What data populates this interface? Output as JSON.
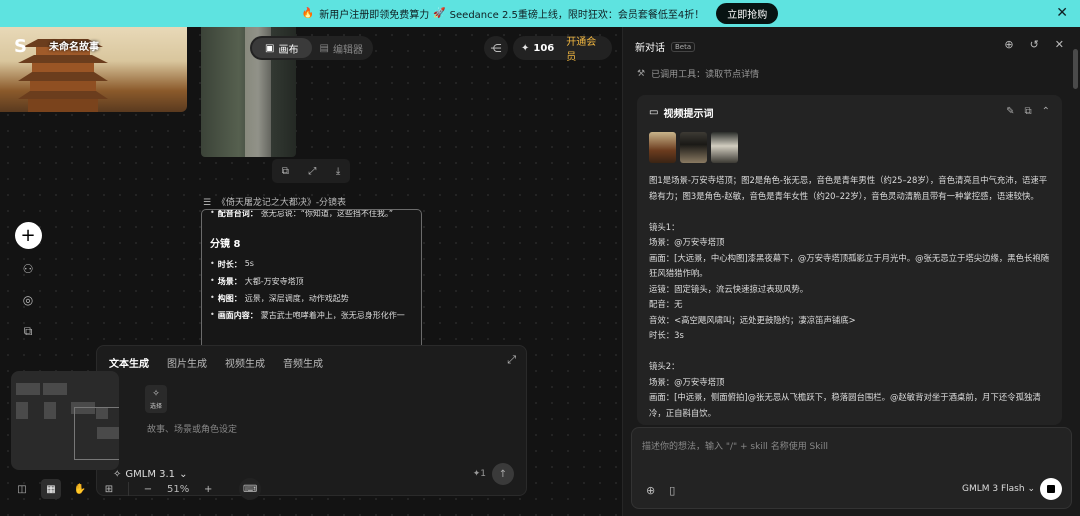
{
  "banner": {
    "icon": "fire-icon",
    "text_prefix": "新用户注册即领免费算力",
    "text_suffix": "Seedance 2.5重磅上线，限时狂欢：会员套餐低至4折！",
    "cta": "立即抢购"
  },
  "canvas": {
    "story_title": "未命名故事",
    "mode_tabs": [
      "画布",
      "编辑器"
    ],
    "credits": "106",
    "vip_label": "开通会员",
    "storyboard_heading": "《倚天屠龙记之大都决》-分镜表",
    "card": {
      "dialogue_label": "配音台词：",
      "dialogue_text": "张无忌说：“你知道，这些挡不住我。”",
      "shot_title": "分镜 8",
      "rows": [
        {
          "k": "时长：",
          "v": "5s"
        },
        {
          "k": "场景：",
          "v": "大都-万安寺塔顶"
        },
        {
          "k": "构图：",
          "v": "远景，深层调度，动作戏起势"
        },
        {
          "k": "画面内容：",
          "v": "蒙古武士咆哮着冲上，张无忌身形化作一"
        }
      ]
    }
  },
  "gen_panel": {
    "tabs": [
      "文本生成",
      "图片生成",
      "视频生成",
      "音频生成"
    ],
    "select_label": "选择",
    "input_placeholder": "故事、场景或角色设定",
    "model": "GMLM 3.1",
    "cost": "1"
  },
  "bottom_bar": {
    "zoom": "51%"
  },
  "chat": {
    "title": "新对话",
    "beta": "Beta",
    "tool_used": "已调用工具：读取节点详情",
    "card_title": "视频提示词",
    "intro": "图1是场景-万安寺塔顶；图2是角色-张无忌，音色是青年男性（约25–28岁），音色清亮且中气充沛，语速平稳有力；图3是角色-赵敏，音色是青年女性（约20–22岁），音色灵动清脆且带有一种掌控感，语速较快。",
    "shot1": [
      "镜头1：",
      "场景：@万安寺塔顶",
      "画面：[大远景，中心构图]漆黑夜幕下，@万安寺塔顶孤影立于月光中。@张无忌立于塔尖边缘，黑色长袍随狂风猎猎作响。",
      "运镜：固定镜头，流云快速掠过表现风势。",
      "配音：无",
      "音效：<高空飓风啸叫；远处更鼓隐约；凄凉笛声铺底>",
      "时长：3s"
    ],
    "shot2": [
      "镜头2：",
      "场景：@万安寺塔顶",
      "画面：[中远景，侧面俯拍]@张无忌从飞檐跃下，稳落圆台围栏。@赵敏背对坐于酒桌前，月下还令孤独清冷，正自斟自饮。"
    ],
    "input_placeholder": "描述你的想法，输入 \"/\" + skill 名称使用 Skill",
    "model": "GMLM 3 Flash"
  }
}
